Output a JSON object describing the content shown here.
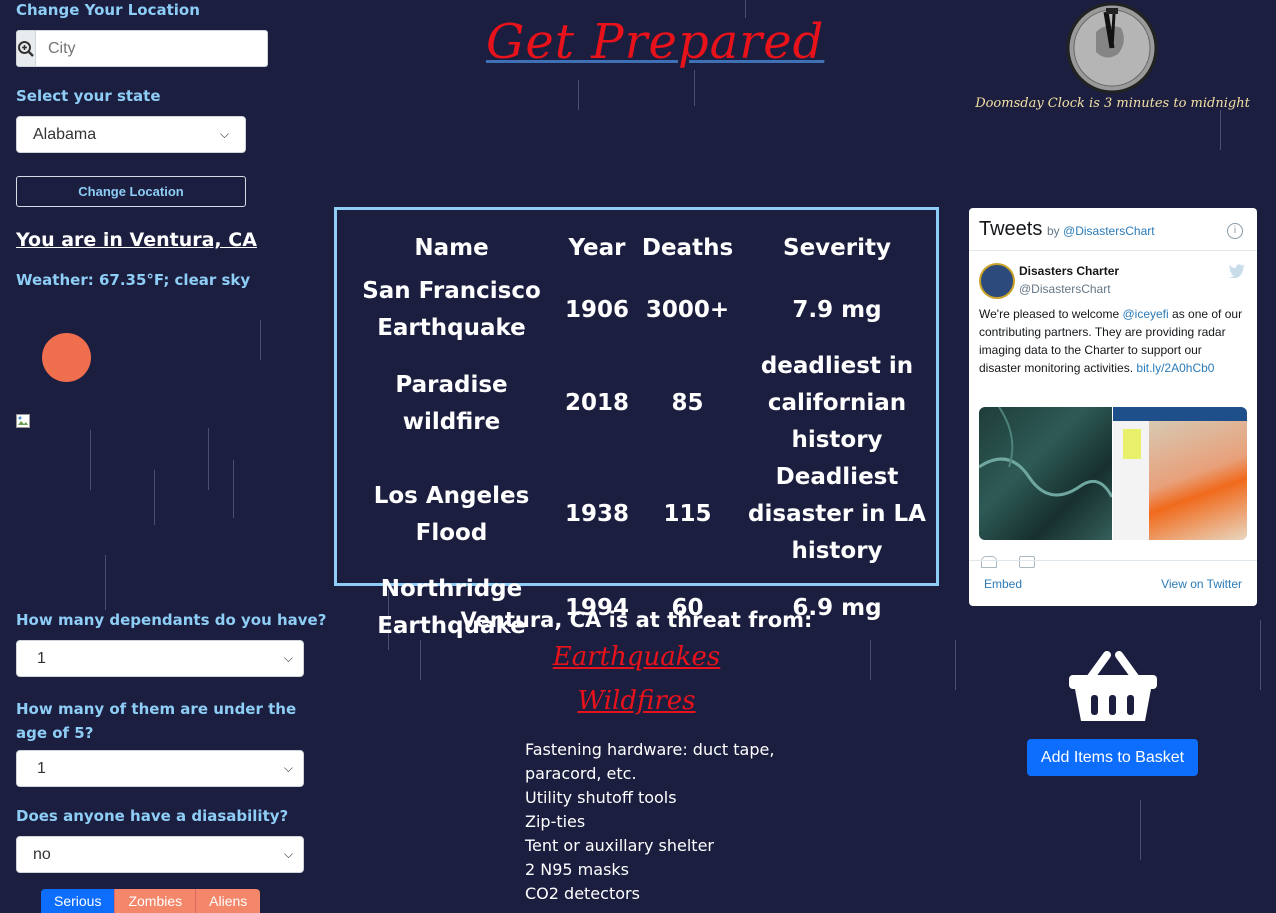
{
  "location": {
    "change_heading": "Change Your Location",
    "city_placeholder": "City",
    "state_label": "Select your state",
    "state_value": "Alabama",
    "change_button": "Change Location",
    "you_are_in": "You are in Ventura, CA",
    "weather": "Weather: 67.35°F; clear sky"
  },
  "header": {
    "title": "Get Prepared",
    "clock_caption": "Doomsday Clock is 3 minutes to midnight"
  },
  "disasters": {
    "headers": [
      "Name",
      "Year",
      "Deaths",
      "Severity"
    ],
    "rows": [
      [
        "San Francisco Earthquake",
        "1906",
        "3000+",
        "7.9 mg"
      ],
      [
        "Paradise wildfire",
        "2018",
        "85",
        "deadliest in californian history"
      ],
      [
        "Los Angeles Flood",
        "1938",
        "115",
        "Deadliest disaster in LA history"
      ],
      [
        "Northridge Earthquake",
        "1994",
        "60",
        "6.9 mg"
      ]
    ]
  },
  "threat": {
    "heading": "Ventura, CA is at threat from:",
    "items": [
      "Earthquakes",
      "Wildfires"
    ]
  },
  "supplies": [
    "Fastening hardware: duct tape, paracord, etc.",
    "Utility shutoff tools",
    "Zip-ties",
    "Tent or auxillary shelter",
    "2 N95 masks",
    "CO2 detectors"
  ],
  "questions": {
    "dependants_label": "How many dependants do you have?",
    "dependants_value": "1",
    "under5_label": "How many of them are under the age of 5?",
    "under5_value": "1",
    "disability_label": "Does anyone have a diasability?",
    "disability_value": "no"
  },
  "mode_tabs": [
    "Serious",
    "Zombies",
    "Aliens"
  ],
  "twitter": {
    "title": "Tweets",
    "by": "by",
    "handle_link": "@DisastersChart",
    "author_name": "Disasters Charter",
    "author_handle": "@DisastersChart",
    "text_before": "We're pleased to welcome ",
    "mention": "@iceyefi",
    "text_after": " as one of our contributing partners. They are providing radar imaging data to the Charter to support our disaster monitoring activities. ",
    "link": "bit.ly/2A0hCb0",
    "embed": "Embed",
    "view_on_twitter": "View on Twitter"
  },
  "basket_button": "Add Items to Basket",
  "colors": {
    "background": "#1b1e3f",
    "accent_blue": "#8ecdf5",
    "title_red": "#e8121b",
    "primary": "#0d6efd",
    "sun": "#ee6e4d",
    "tab_inactive": "#f4866a"
  }
}
